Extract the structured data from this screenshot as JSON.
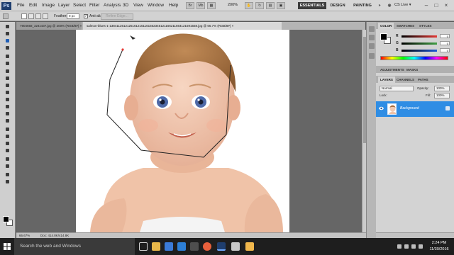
{
  "menubar": {
    "logo": "Ps",
    "items": [
      "File",
      "Edit",
      "Image",
      "Layer",
      "Select",
      "Filter",
      "Analysis",
      "3D",
      "View",
      "Window",
      "Help"
    ],
    "zoom": "200%",
    "workspaces": [
      "ESSENTIALS",
      "DESIGN",
      "PAINTING"
    ],
    "more": "»",
    "cs_live": "CS Live ▾",
    "window_controls": [
      "–",
      "□",
      "×"
    ]
  },
  "options": {
    "feather_label": "Feather:",
    "feather_value": "0 px",
    "antialias_label": "Anti-alias",
    "antialias_checked": "✓",
    "refine_edge_label": "Refine Edge..."
  },
  "tabs": [
    {
      "label": "7904658_324x437.jpg @ 200% (RGB/8#)",
      "close": "×"
    },
    {
      "label": "salmon-blues-1-13841126121251612151161562345121166211564121591558.jpg @ 66.7% (RGB/8#)",
      "close": "×"
    }
  ],
  "status": {
    "zoom": "66.67%",
    "doc_size": "Doc: 414.8K/414.8K"
  },
  "panels": {
    "color_tabs": [
      "COLOR",
      "SWATCHES",
      "STYLES"
    ],
    "sliders": [
      {
        "label": "R",
        "value": "0",
        "color": "#e53935"
      },
      {
        "label": "G",
        "value": "0",
        "color": "#43a047"
      },
      {
        "label": "B",
        "value": "0",
        "color": "#1e5bd8"
      }
    ],
    "adjust_tabs": [
      "ADJUSTMENTS",
      "MASKS"
    ],
    "layers_tabs": [
      "LAYERS",
      "CHANNELS",
      "PATHS"
    ],
    "blend_mode": "Normal",
    "opacity_label": "Opacity:",
    "opacity_value": "100%",
    "lock_label": "Lock:",
    "fill_label": "Fill:",
    "fill_value": "100%",
    "layer_name": "Background"
  },
  "taskbar": {
    "search_placeholder": "Search the web and Windows",
    "time": "2:24 PM",
    "date": "11/30/2016"
  },
  "colors": {
    "accent_layer": "#2f8de4",
    "menubar": "#d6d6d6",
    "taskbar": "#1e1e1e"
  }
}
